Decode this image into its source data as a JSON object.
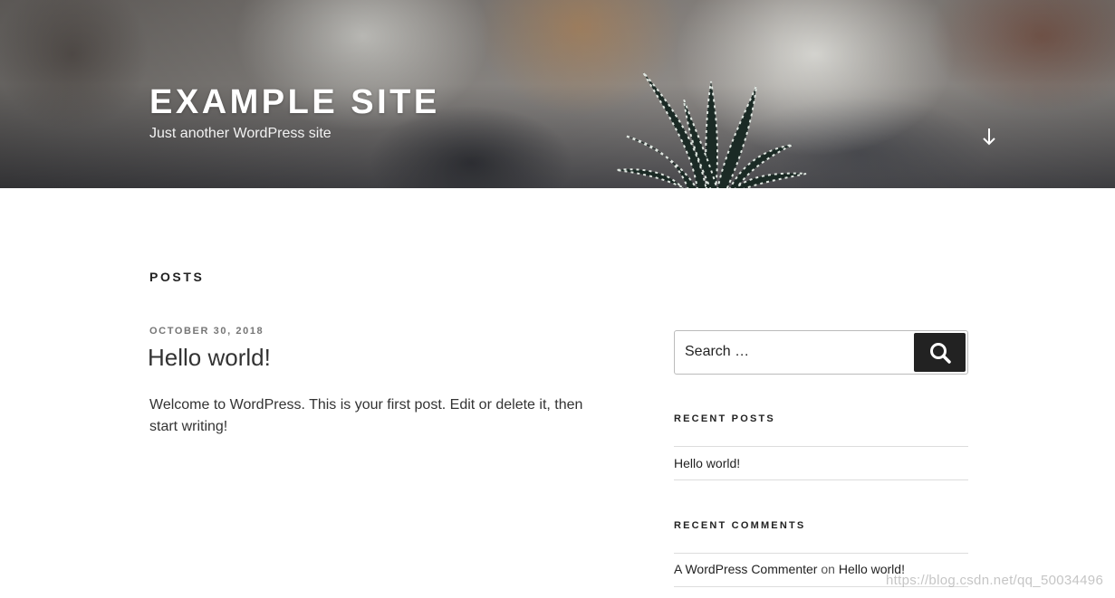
{
  "header": {
    "site_title": "EXAMPLE SITE",
    "site_description": "Just another WordPress site",
    "scroll_icon": "arrow-down-icon"
  },
  "main": {
    "page_title": "POSTS",
    "post": {
      "date": "OCTOBER 30, 2018",
      "title": "Hello world!",
      "content": "Welcome to WordPress. This is your first post. Edit or delete it, then start writing!"
    }
  },
  "sidebar": {
    "search": {
      "placeholder": "Search …",
      "button_icon": "search-icon"
    },
    "recent_posts": {
      "title": "RECENT POSTS",
      "items": [
        "Hello world!"
      ]
    },
    "recent_comments": {
      "title": "RECENT COMMENTS",
      "author": "A WordPress Commenter",
      "connector": "on",
      "post": "Hello world!"
    }
  },
  "watermark": "https://blog.csdn.net/qq_50034496",
  "colors": {
    "text": "#333333",
    "button": "#222222",
    "date": "#767676"
  }
}
